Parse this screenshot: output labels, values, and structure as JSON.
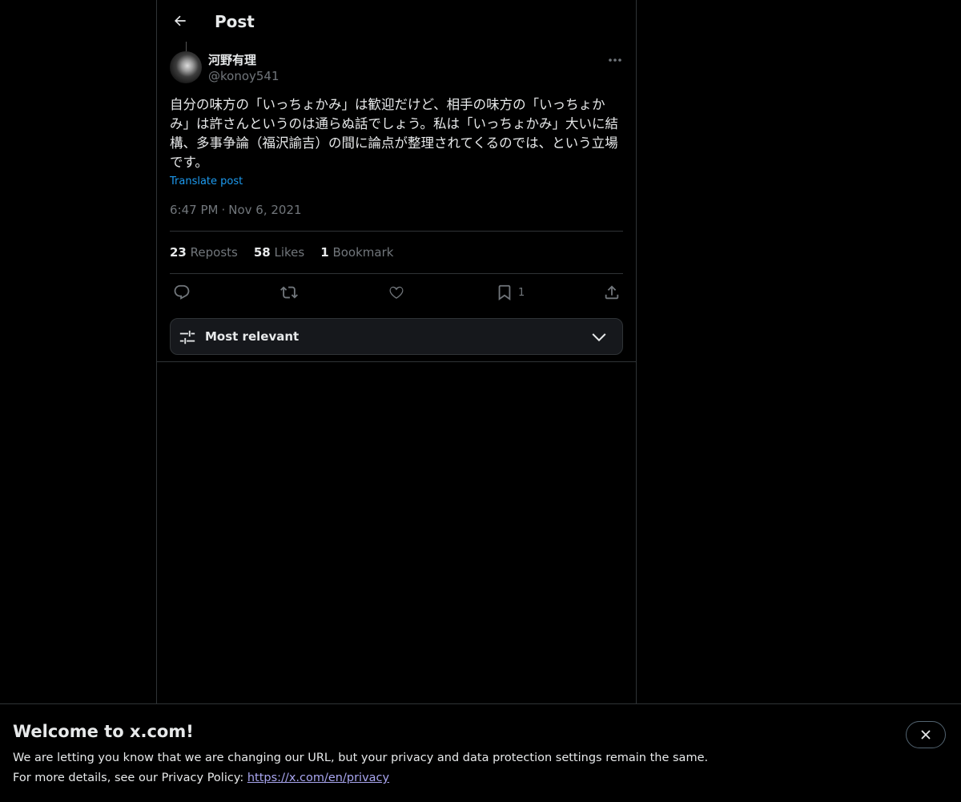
{
  "header": {
    "title": "Post",
    "back_icon": "arrow-left-icon"
  },
  "post": {
    "author_name": "河野有理",
    "author_handle": "@konoy541",
    "text": "自分の味方の「いっちょかみ」は歓迎だけど、相手の味方の「いっちょかみ」は許さんというのは通らぬ話でしょう。私は「いっちょかみ」大いに結構、多事争論（福沢諭吉）の間に論点が整理されてくるのでは、という立場です。",
    "translate_label": "Translate post",
    "time": "6:47 PM",
    "separator": "·",
    "date": "Nov 6, 2021",
    "stats": {
      "reposts_count": "23",
      "reposts_label": "Reposts",
      "likes_count": "58",
      "likes_label": "Likes",
      "bookmarks_count": "1",
      "bookmarks_label": "Bookmark"
    },
    "actions": {
      "reply_icon": "reply-icon",
      "repost_icon": "repost-icon",
      "like_icon": "like-icon",
      "bookmark_icon": "bookmark-icon",
      "bookmark_count": "1",
      "share_icon": "share-icon"
    }
  },
  "replies_sort": {
    "label": "Most relevant",
    "icon": "sliders-icon",
    "chevron": "chevron-down-icon"
  },
  "banner": {
    "title": "Welcome to x.com!",
    "line1": "We are letting you know that we are changing our URL, but your privacy and data protection settings remain the same.",
    "line2_prefix": "For more details, see our Privacy Policy: ",
    "link_text": "https://x.com/en/privacy",
    "close_icon": "close-icon"
  },
  "colors": {
    "background": "#000000",
    "text": "#e7e9ea",
    "secondary_text": "#71767b",
    "accent": "#1d9bf0",
    "border": "#2f3336",
    "link": "#a9a6f0"
  }
}
